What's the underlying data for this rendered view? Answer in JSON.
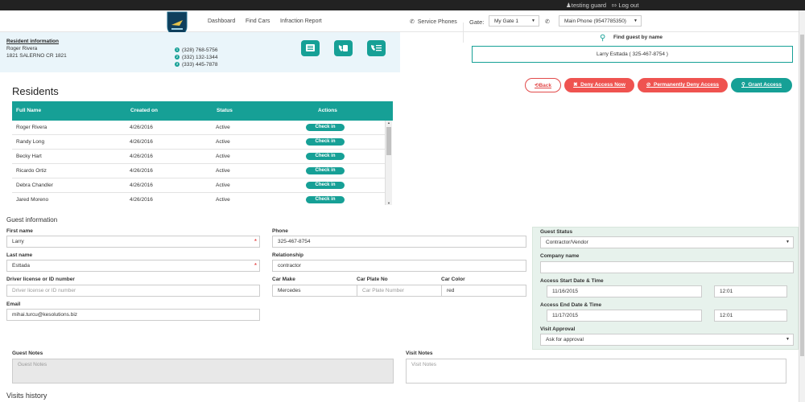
{
  "topbar": {
    "user": "testing guard",
    "logout": "Log out"
  },
  "nav": {
    "links": [
      "Dashboard",
      "Find Cars",
      "Infraction Report"
    ],
    "service_phones": "Service Phones",
    "gate_label": "Gate:",
    "gate_value": "My Gate 1",
    "phone_value": "Main Phone (9547785350)"
  },
  "resident": {
    "title": "Resident information",
    "name": "Roger Rivera",
    "address": "1821 SALERNO CR 1821",
    "phones": [
      "(328) 768-5756",
      "(332) 132-1344",
      "(333) 445-7878"
    ]
  },
  "find_guest": {
    "label": "Find guest by name",
    "value": "Larry Esttada ( 325-467-8754 )"
  },
  "actions": {
    "back": "Back",
    "deny_now": "Deny Access Now",
    "perm_deny": "Permanently Deny Access",
    "grant": "Grant Access"
  },
  "residents": {
    "heading": "Residents",
    "columns": [
      "Full Name",
      "Created on",
      "Status",
      "Actions"
    ],
    "checkin_label": "Check in",
    "rows": [
      {
        "name": "Roger Rivera",
        "created": "4/26/2016",
        "status": "Active"
      },
      {
        "name": "Randy Long",
        "created": "4/26/2016",
        "status": "Active"
      },
      {
        "name": "Becky Hart",
        "created": "4/26/2016",
        "status": "Active"
      },
      {
        "name": "Ricardo Ortiz",
        "created": "4/26/2016",
        "status": "Active"
      },
      {
        "name": "Debra Chandler",
        "created": "4/26/2016",
        "status": "Active"
      },
      {
        "name": "Jared Moreno",
        "created": "4/26/2016",
        "status": "Active"
      }
    ]
  },
  "guest": {
    "heading": "Guest information",
    "first_name_label": "First name",
    "first_name": "Larry",
    "last_name_label": "Last name",
    "last_name": "Esttada",
    "license_label": "Driver license or ID number",
    "license_placeholder": "Driver license or ID number",
    "email_label": "Email",
    "email": "mihai.turcu@kesolutions.biz",
    "phone_label": "Phone",
    "phone": "325-467-8754",
    "relationship_label": "Relationship",
    "relationship": "contractor",
    "car_make_label": "Car Make",
    "car_make": "Mercedes",
    "car_plate_label": "Car Plate No",
    "car_plate_placeholder": "Car Plate Number",
    "car_color_label": "Car Color",
    "car_color": "red"
  },
  "status_panel": {
    "guest_status_label": "Guest Status",
    "guest_status": "Contractor/Vendor",
    "company_label": "Company name",
    "start_label": "Access Start Date & Time",
    "start_date": "11/16/2015",
    "start_time": "12:01",
    "end_label": "Access End Date & Time",
    "end_date": "11/17/2015",
    "end_time": "12:01",
    "visit_approval_label": "Visit Approval",
    "visit_approval": "Ask for approval"
  },
  "notes": {
    "guest_notes_label": "Guest Notes",
    "guest_notes_placeholder": "Guest Notes",
    "visit_notes_label": "Visit Notes",
    "visit_notes_placeholder": "Visit Notes"
  },
  "visits_history": "Visits history",
  "colors": {
    "teal": "#16a096",
    "red": "#ef5350",
    "topbar": "#222222"
  }
}
